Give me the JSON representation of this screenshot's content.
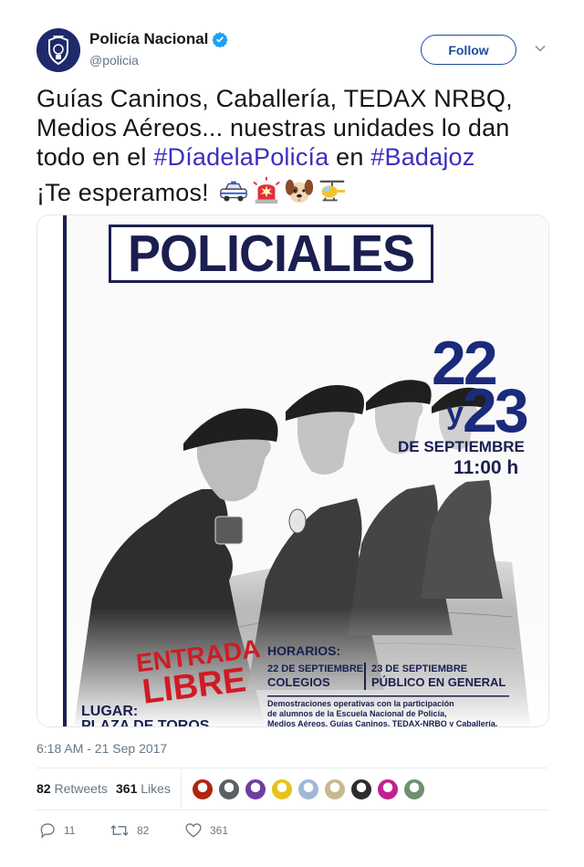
{
  "account": {
    "display_name": "Policía Nacional",
    "handle": "@policia",
    "verified": true,
    "avatar_icon": "police-badge-icon"
  },
  "follow_label": "Follow",
  "menu_icon": "chevron-down-icon",
  "tweet": {
    "line1": "Guías Caninos, Caballería, TEDAX NRBQ,",
    "line2": "Medios Aéreos... nuestras unidades lo dan",
    "line3_prefix": "todo en el ",
    "hashtag1": "#DíadelaPolicía",
    "line3_mid": " en ",
    "hashtag2": "#Badajoz",
    "line4": "¡Te esperamos!",
    "emojis": [
      "police-car-icon",
      "rotating-light-icon",
      "dog-face-icon",
      "helicopter-icon"
    ]
  },
  "poster": {
    "title": "POLICIALES",
    "day1": "22",
    "y": "y",
    "day2": "23",
    "month": "DE SEPTIEMBRE",
    "time": "11:00 h",
    "entrada1": "ENTRADA",
    "entrada2": "LIBRE",
    "horarios_title": "HORARIOS:",
    "sched1_date": "22 DE SEPTIEMBRE",
    "sched1_who": "COLEGIOS",
    "sched2_date": "23 DE SEPTIEMBRE",
    "sched2_who": "PÚBLICO EN GENERAL",
    "desc1": "Demostraciones operativas con la participación",
    "desc2": "de alumnos de la Escuela Nacional de Policía,",
    "desc3": "Medios Aéreos, Guías Caninos, TEDAX-NRBQ y Caballería.",
    "lugar_label": "LUGAR:",
    "lugar_value": "PLAZA DE TOROS"
  },
  "timestamp": "6:18 AM - 21 Sep 2017",
  "stats": {
    "retweets_count": "82",
    "retweets_label": "Retweets",
    "likes_count": "361",
    "likes_label": "Likes"
  },
  "liker_avatars": [
    "#b0260f",
    "#5a5f66",
    "#6b3fa0",
    "#e8c21a",
    "#9fb8d8",
    "#c9b990",
    "#2d2d2d",
    "#c2208f",
    "#6f8f6f"
  ],
  "actions": {
    "reply_count": "11",
    "retweet_count": "82",
    "like_count": "361"
  },
  "colors": {
    "link": "#3b2fbf",
    "follow": "#1d4ba0",
    "muted": "#657786",
    "verified": "#1da1f2",
    "poster_navy": "#1b1f4f",
    "poster_red": "#d01b23"
  }
}
